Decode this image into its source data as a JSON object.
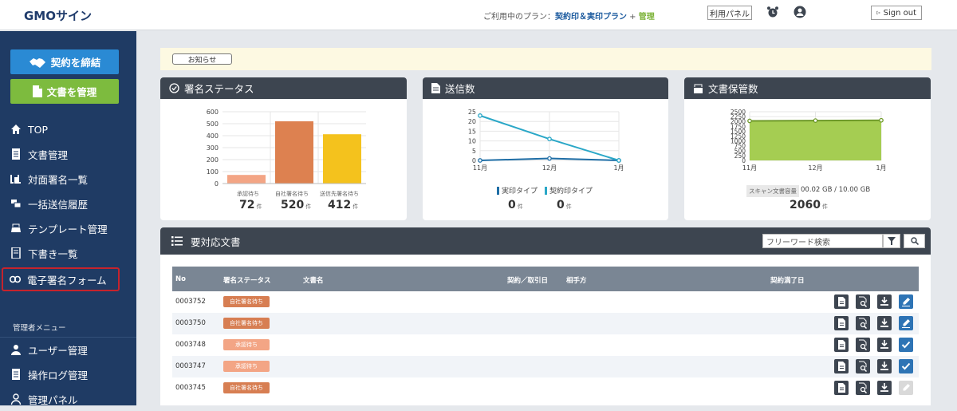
{
  "header": {
    "logo": "GMOサイン",
    "plan_prefix": "ご利用中のプラン：",
    "plan_name": "契約印＆実印プラン",
    "plan_plus": " + ",
    "plan_admin": "管理",
    "admin_panel_button": "利用パネル",
    "sign_out": "Sign out"
  },
  "sidebar": {
    "btn_contract": "契約を締結",
    "btn_documents": "文書を管理",
    "items": [
      {
        "label": "TOP",
        "icon": "home-icon"
      },
      {
        "label": "文書管理",
        "icon": "document-icon"
      },
      {
        "label": "対面署名一覧",
        "icon": "face-sign-icon"
      },
      {
        "label": "一括送信履歴",
        "icon": "bulk-send-icon"
      },
      {
        "label": "テンプレート管理",
        "icon": "template-icon"
      },
      {
        "label": "下書き一覧",
        "icon": "draft-icon"
      },
      {
        "label": "電子署名フォーム",
        "icon": "link-icon"
      }
    ],
    "admin_header": "管理者メニュー",
    "admin_items": [
      {
        "label": "ユーザー管理",
        "icon": "user-icon"
      },
      {
        "label": "操作ログ管理",
        "icon": "log-icon"
      },
      {
        "label": "管理パネル",
        "icon": "admin-panel-icon"
      }
    ]
  },
  "notice_button": "お知らせ",
  "panels": {
    "sign_status": {
      "title": "署名ステータス",
      "stats": [
        {
          "label": "承認待ち",
          "value": "72",
          "unit": "件"
        },
        {
          "label": "自社署名待ち",
          "value": "520",
          "unit": "件"
        },
        {
          "label": "送信先署名待ち",
          "value": "412",
          "unit": "件"
        }
      ]
    },
    "sent": {
      "title": "送信数",
      "legend": [
        "実印タイプ",
        "契約印タイプ"
      ],
      "stats": [
        {
          "value": "0",
          "unit": "件"
        },
        {
          "value": "0",
          "unit": "件"
        }
      ]
    },
    "storage": {
      "title": "文書保管数",
      "capacity_label": "スキャン文書容量",
      "capacity_value": "00.02 GB / 10.00 GB",
      "count": "2060",
      "unit": "件"
    },
    "pending": {
      "title": "要対応文書",
      "search_placeholder": "フリーワード検索",
      "columns": {
        "no": "No",
        "status": "署名ステータス",
        "doc": "文書名",
        "date": "契約／取引日",
        "party": "相手方",
        "end": "契約満了日"
      },
      "rows": [
        {
          "no": "0003752",
          "status": "自社署名待ち",
          "kind": "self",
          "last": "sign"
        },
        {
          "no": "0003750",
          "status": "自社署名待ち",
          "kind": "self",
          "last": "sign"
        },
        {
          "no": "0003748",
          "status": "承認待ち",
          "kind": "appr",
          "last": "approve"
        },
        {
          "no": "0003747",
          "status": "承認待ち",
          "kind": "appr",
          "last": "approve"
        },
        {
          "no": "0003745",
          "status": "自社署名待ち",
          "kind": "self",
          "last": "disabled"
        }
      ]
    }
  },
  "colors": {
    "sidebar": "#1f3b64",
    "panel_header": "#3d4550",
    "accent_blue": "#2a8ad4",
    "accent_green": "#7dbb3e",
    "bar_approval": "#f3a585",
    "bar_self": "#dd8150",
    "bar_partner": "#f4c21d",
    "line_jitsuin": "#1f6ea6",
    "line_keiyaku": "#2aa7c7",
    "storage_fill": "#a5cd52",
    "highlight": "#c6232c"
  },
  "chart_data": [
    {
      "type": "bar",
      "title": "署名ステータス",
      "categories": [
        "承認待ち",
        "自社署名待ち",
        "送信先署名待ち"
      ],
      "values": [
        72,
        520,
        412
      ],
      "ylim": [
        0,
        600
      ],
      "yticks": [
        0,
        100,
        200,
        300,
        400,
        500,
        600
      ],
      "grid": true
    },
    {
      "type": "line",
      "title": "送信数",
      "categories": [
        "11月",
        "12月",
        "1月"
      ],
      "series": [
        {
          "name": "実印タイプ",
          "values": [
            0,
            1,
            0
          ]
        },
        {
          "name": "契約印タイプ",
          "values": [
            23,
            11,
            0
          ]
        }
      ],
      "ylim": [
        0,
        25
      ],
      "yticks": [
        0,
        5,
        10,
        15,
        20,
        25
      ],
      "grid": true
    },
    {
      "type": "area",
      "title": "文書保管数",
      "categories": [
        "11月",
        "12月",
        "1月"
      ],
      "series": [
        {
          "name": "",
          "values": [
            2030,
            2045,
            2060
          ]
        }
      ],
      "ylim": [
        0,
        2500
      ],
      "yticks": [
        0,
        250,
        500,
        750,
        1000,
        1250,
        1500,
        1750,
        2000,
        2250,
        2500
      ],
      "grid": true
    }
  ]
}
